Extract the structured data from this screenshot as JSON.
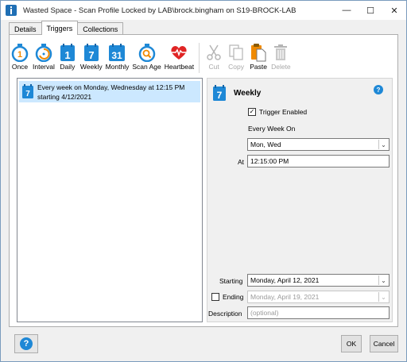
{
  "window": {
    "title": "Wasted Space - Scan Profile Locked by LAB\\brock.bingham on S19-BROCK-LAB",
    "minimize": "—",
    "maximize": "☐",
    "close": "✕"
  },
  "tabs": [
    {
      "label": "Details",
      "active": false
    },
    {
      "label": "Triggers",
      "active": true
    },
    {
      "label": "Collections",
      "active": false
    }
  ],
  "toolbar": {
    "once": "Once",
    "interval": "Interval",
    "daily": "Daily",
    "weekly": "Weekly",
    "monthly": "Monthly",
    "scan_age": "Scan Age",
    "heartbeat": "Heartbeat",
    "cut": "Cut",
    "copy": "Copy",
    "paste": "Paste",
    "delete": "Delete",
    "daily_num": "1",
    "weekly_num": "7",
    "monthly_num": "31"
  },
  "triggers_list": [
    {
      "line1": "Every week on Monday, Wednesday at 12:15 PM",
      "line2": "starting 4/12/2021",
      "icon_num": "7"
    }
  ],
  "detail": {
    "title": "Weekly",
    "icon_num": "7",
    "trigger_enabled_label": "Trigger Enabled",
    "trigger_enabled": true,
    "every_week_on_label": "Every Week On",
    "days_value": "Mon, Wed",
    "at_label": "At",
    "at_value": "12:15:00 PM",
    "starting_label": "Starting",
    "starting_value": "Monday, April 12, 2021",
    "ending_label": "Ending",
    "ending_value": "Monday, April 19, 2021",
    "ending_enabled": false,
    "description_label": "Description",
    "description_placeholder": "(optional)"
  },
  "buttons": {
    "help": "?",
    "ok": "OK",
    "cancel": "Cancel"
  },
  "colors": {
    "accent_blue": "#1e88d6",
    "selection": "#cce8ff",
    "heartbeat_red": "#e02424",
    "paste_orange": "#f08a00"
  }
}
